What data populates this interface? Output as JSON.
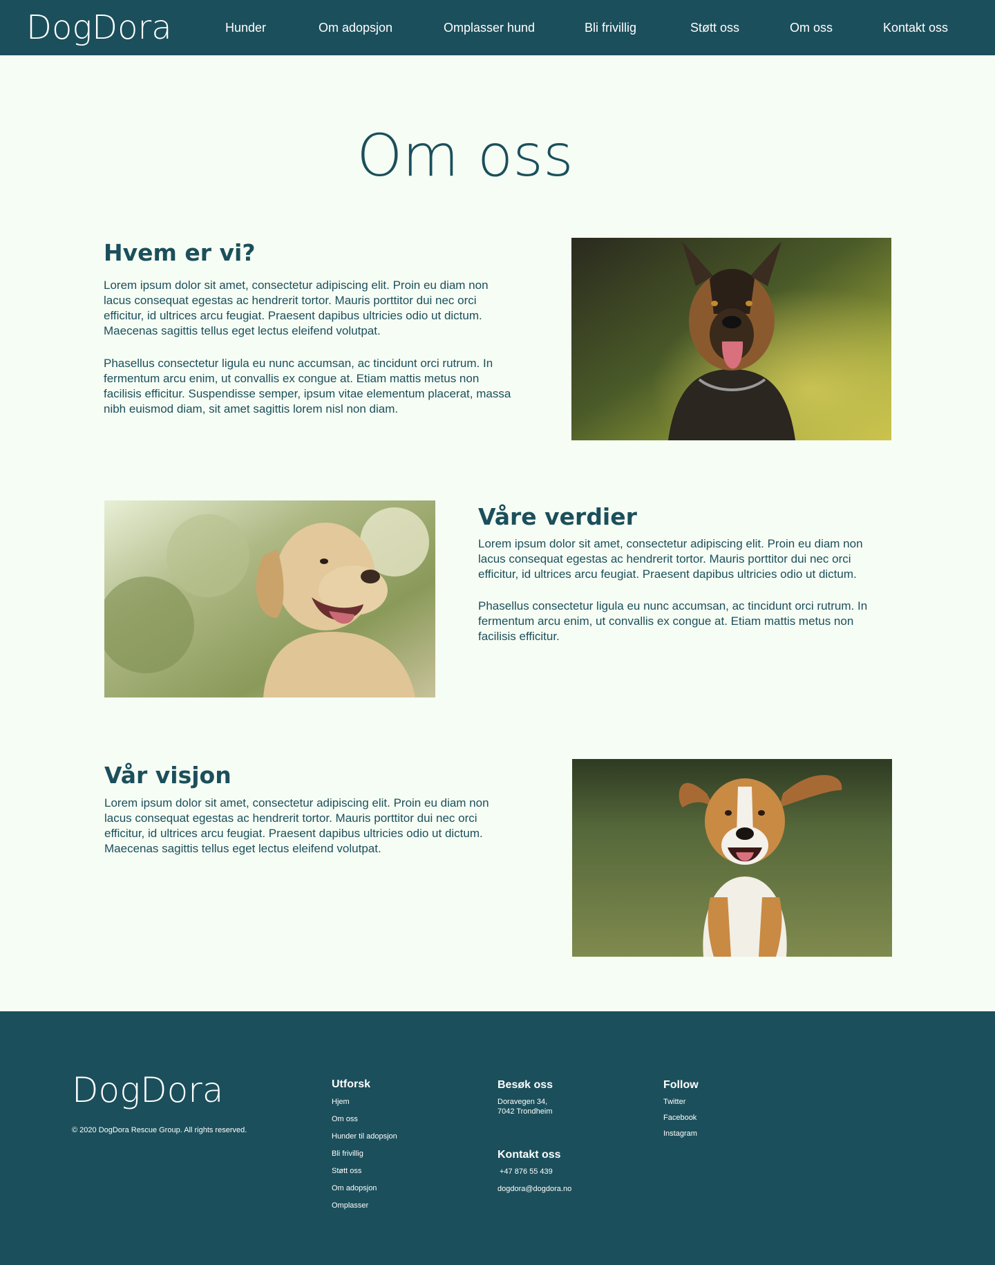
{
  "nav": {
    "logo": "DogDora",
    "links": [
      "Hunder",
      "Om adopsjon",
      "Omplasser hund",
      "Bli frivillig",
      "Støtt oss",
      "Om oss",
      "Kontakt oss"
    ]
  },
  "page": {
    "title": "Om oss"
  },
  "sections": {
    "who": {
      "heading": "Hvem er vi?",
      "p1": "Lorem ipsum dolor sit amet, consectetur adipiscing elit. Proin eu diam non lacus consequat egestas ac hendrerit tortor. Mauris porttitor dui nec orci efficitur, id ultrices arcu feugiat. Praesent dapibus ultricies odio ut dictum. Maecenas sagittis tellus eget lectus eleifend volutpat.",
      "p2": "Phasellus consectetur ligula eu nunc accumsan, ac tincidunt orci rutrum. In fermentum arcu enim, ut convallis ex congue at. Etiam mattis metus non facilisis efficitur. Suspendisse semper, ipsum vitae elementum placerat, massa nibh euismod diam, sit amet sagittis lorem nisl non diam."
    },
    "values": {
      "heading": "Våre verdier",
      "p1": "Lorem ipsum dolor sit amet, consectetur adipiscing elit. Proin eu diam non lacus consequat egestas ac hendrerit tortor. Mauris porttitor dui nec orci efficitur, id ultrices arcu feugiat. Praesent dapibus ultricies odio ut dictum.",
      "p2": "Phasellus consectetur ligula eu nunc accumsan, ac tincidunt orci rutrum. In fermentum arcu enim, ut convallis ex congue at. Etiam mattis metus non facilisis efficitur."
    },
    "vision": {
      "heading": "Vår visjon",
      "p1": "Lorem ipsum dolor sit amet, consectetur adipiscing elit. Proin eu diam non lacus consequat egestas ac hendrerit tortor. Mauris porttitor dui nec orci efficitur, id ultrices arcu feugiat. Praesent dapibus ultricies odio ut dictum. Maecenas sagittis tellus eget lectus eleifend volutpat."
    }
  },
  "footer": {
    "logo": "DogDora",
    "copyright": "© 2020 DogDora Rescue Group. All rights reserved.",
    "explore": {
      "heading": "Utforsk",
      "links": [
        "Hjem",
        "Om oss",
        "Hunder til adopsjon",
        "Bli frivillig",
        "Støtt oss",
        "Om adopsjon",
        "Omplasser"
      ]
    },
    "visit": {
      "heading": "Besøk oss",
      "address_line1": "Doravegen 34,",
      "address_line2": "7042 Trondheim"
    },
    "contact": {
      "heading": "Kontakt oss",
      "phone": "+47 876 55 439",
      "email": "dogdora@dogdora.no"
    },
    "follow": {
      "heading": "Follow",
      "links": [
        "Twitter",
        "Facebook",
        "Instagram"
      ]
    }
  },
  "colors": {
    "primary": "#1b4f5b",
    "background": "#f6fdf4",
    "text_light": "#ffffff"
  }
}
